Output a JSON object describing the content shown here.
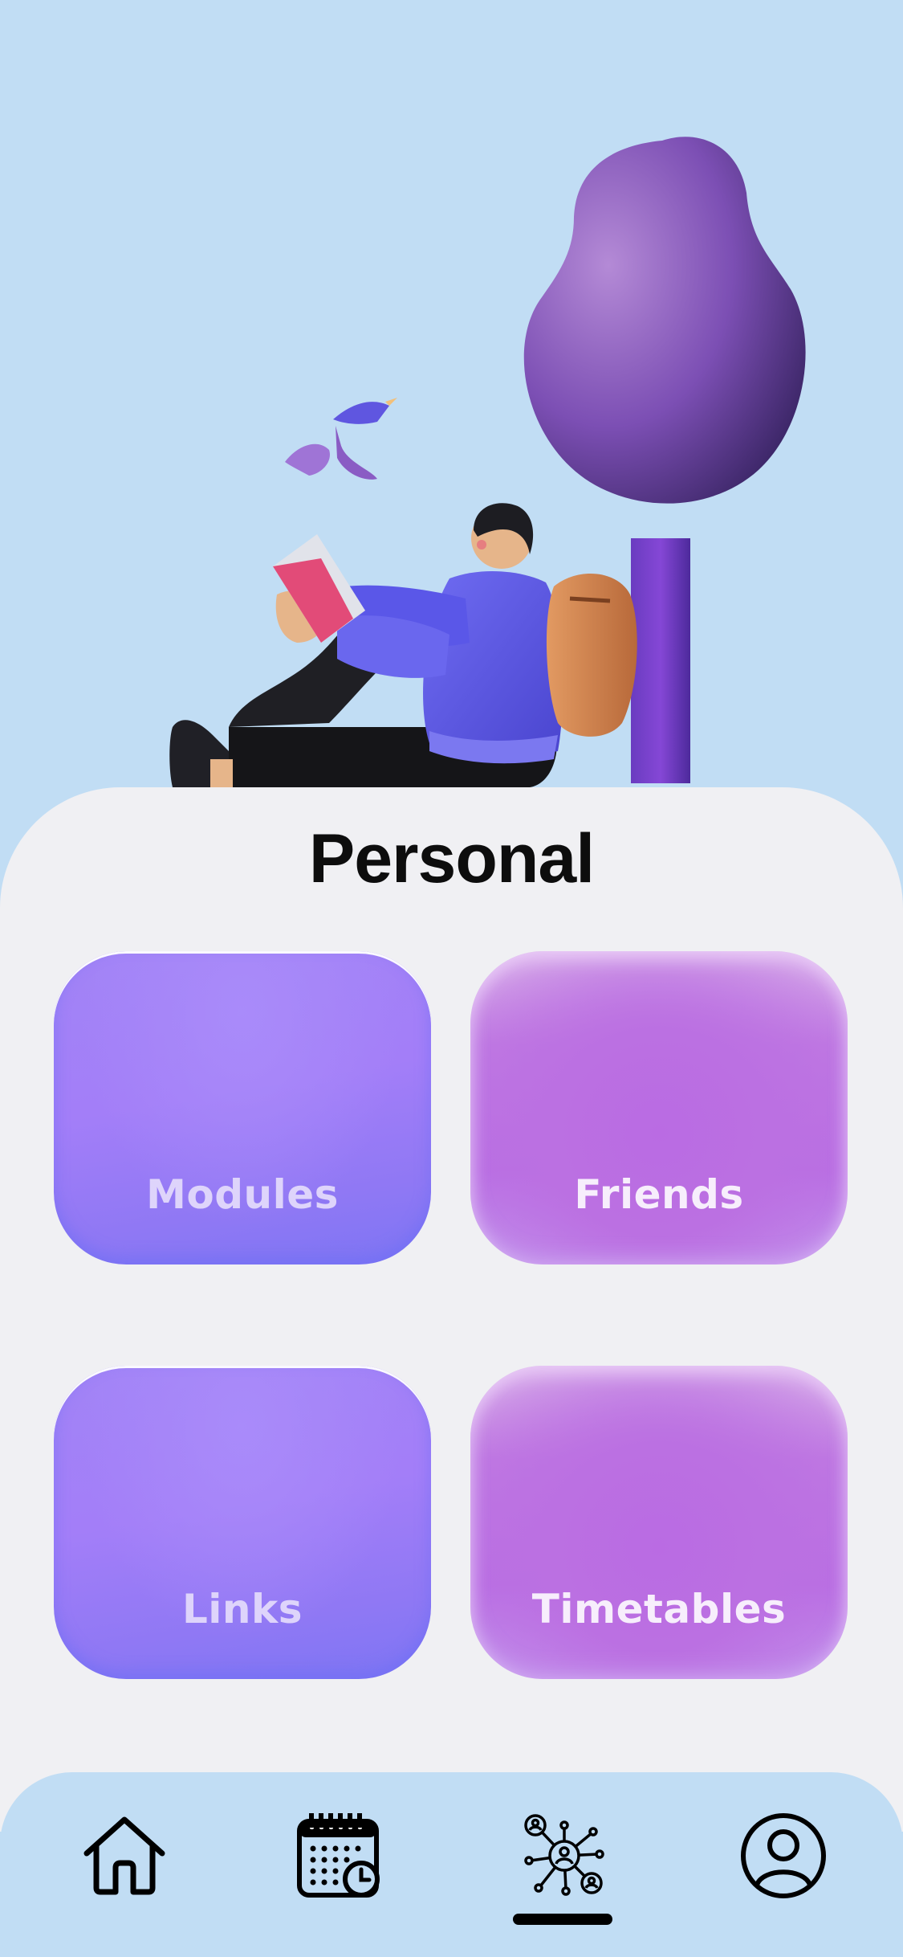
{
  "page": {
    "title": "Personal"
  },
  "cards": {
    "modules": {
      "label": "Modules"
    },
    "friends": {
      "label": "Friends"
    },
    "links": {
      "label": "Links"
    },
    "timetables": {
      "label": "Timetables"
    }
  },
  "tabbar": {
    "items": [
      {
        "icon": "home-icon"
      },
      {
        "icon": "calendar-clock-icon"
      },
      {
        "icon": "network-people-icon",
        "active": true
      },
      {
        "icon": "profile-icon"
      }
    ]
  },
  "colors": {
    "background": "#c1ddf4",
    "sheet": "#f0f0f3",
    "card_blue": "#a37ef8",
    "card_pink": "#bb70e2"
  }
}
